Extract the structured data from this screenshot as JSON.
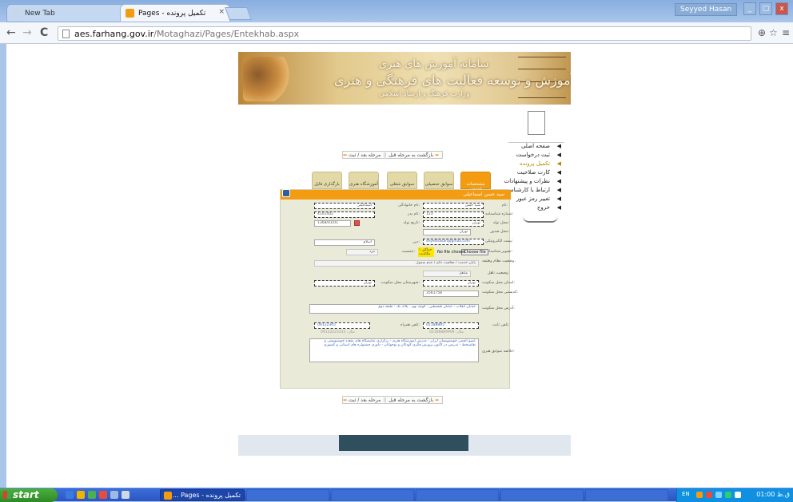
{
  "browser": {
    "tabs": [
      {
        "title": "New Tab",
        "close": "×"
      },
      {
        "title": "تکمیل پرونده - Pages",
        "close": "×"
      }
    ],
    "user": "Seyyed Hasan",
    "window_buttons": [
      "_",
      "▢",
      "x"
    ],
    "url_host": "aes.farhang.gov.ir",
    "url_path": "/Motaghazi/Pages/Entekhab.aspx",
    "nav": {
      "back": "←",
      "forward": "→",
      "reload": "C"
    },
    "toolbar_icons": {
      "zoom": "⊕",
      "star": "☆",
      "menu": "≡"
    }
  },
  "site": {
    "banner": {
      "line1": "سامانه آموزش های هنری",
      "line2": "دفتر آموزش و توسعه فعالیت های فرهنگی و هنری",
      "line3": "وزارت فرهنگ و ارشاد اسلامی"
    },
    "side_menu": [
      {
        "label": "صفحه اصلی",
        "active": false
      },
      {
        "label": "ثبت درخواست",
        "active": false
      },
      {
        "label": "تکمیل پرونده",
        "active": true
      },
      {
        "label": "کارت صلاحیت",
        "active": false
      },
      {
        "label": "نظرات و پیشنهادات",
        "active": false
      },
      {
        "label": "ارتباط با کارشناس",
        "active": false
      },
      {
        "label": "تغییر رمز عبور",
        "active": false
      },
      {
        "label": "خروج",
        "active": false
      }
    ],
    "nav_bar": {
      "next": "مرحله بعد / ثبت",
      "prev": "بازگشت به مرحله قبل",
      "sep": "||"
    },
    "form_tabs": [
      "مشخصات عمومی",
      "سوابق تحصیلی",
      "سوابق شغلی",
      "آموزشگاه هنری",
      "بارگذاری فایل"
    ],
    "form_title": "سید حسن اسماعیلی",
    "fields": {
      "name_label": "نام:",
      "name_value": "سید حسن",
      "lastname_label": "نام خانوادگی:",
      "lastname_value": "اسماعیلی",
      "national_code_label": "شماره شناسنامه:",
      "national_code_value": "123",
      "father_label": "نام پدر:",
      "father_value": "4101402",
      "place_label": "محل تولد:",
      "place_value": "تهران",
      "birth_label": "تاریخ تولد:",
      "birth_value": "1368/01/01",
      "issue_label": "محل صدور:",
      "issue_value": "تهران",
      "email_label": "پست الکترونیکی:",
      "email_value": "seyedhasan@gmail.com",
      "religion_label": "دین:",
      "religion_value": "اسلام",
      "photo_label": "تصویر شناسنامه:",
      "photo_choose": "Choose file",
      "photo_file": "No file chosen",
      "photo_note": "حداکثر ۱ مگابایت",
      "gender_label": "جنسیت:",
      "gender_value": "مرد",
      "military_label": "وضعیت نظام وظیفه:",
      "military_value": "پایان خدمت / معافیت دائم / عدم شمول",
      "marital_label": "وضعیت تاهل:",
      "marital_value": "متاهل",
      "province_label": "استان محل سکونت:",
      "province_value": "تهران",
      "city_label": "شهرستان محل سکونت:",
      "city_value": "تهران",
      "zip_label": "کدپستی محل سکونت:",
      "zip_value": "3561758",
      "address_label": "آدرس محل سکونت:",
      "address_value": "خیابان انقلاب - خیابان فلسطین - کوچه نهم - پلاک یک - طبقه دوم",
      "phone_label": "تلفن ثابت:",
      "phone_value": "02188895",
      "mobile_label": "تلفن همراه:",
      "mobile_value": "09122345",
      "phone_hint": "مثال: 02188889999",
      "mobile_hint": "مثال: 09122223333",
      "resume_label": "خلاصه سوابق هنری:",
      "resume_value": "عضو انجمن خوشنویسان ایران - مدرس آموزشگاه هنری - برگزاری نمایشگاه های متعدد خوشنویسی و نقاشیخط - تدریس در کانون پرورش فکری کودکان و نوجوانان - داوری جشنواره های استانی و کشوری"
    }
  },
  "taskbar": {
    "start": "start",
    "task_active": "تکمیل پرونده - Pages ...",
    "lang": "EN",
    "clock": "01:00 ق.ظ"
  },
  "colors": {
    "accent": "#f39c12",
    "tab_bg": "#e3d9a6",
    "form_bg": "#e9ebd8",
    "footer_bar": "#2f4f5f"
  }
}
